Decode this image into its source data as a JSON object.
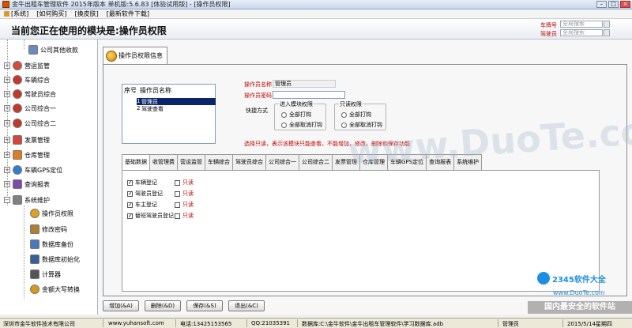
{
  "window": {
    "title": "金牛出租车管理软件 2015年版本 单机版:5.6.83 [体验试用版] - [操作员权限]"
  },
  "menu": [
    {
      "label": "[系统]"
    },
    {
      "label": "[如何购买]"
    },
    {
      "label": "[换皮肤]"
    },
    {
      "label": "[最新软件下载]"
    }
  ],
  "header": {
    "current_module": "当前您正在使用的模块是:操作员权限",
    "plate_label": "车牌号",
    "plate_placeholder": "全局搜索",
    "driver_label": "驾驶员",
    "driver_placeholder": "全局搜索"
  },
  "sidebar": {
    "items": [
      {
        "label": "公司其他收款",
        "icon": "document-icon",
        "color": "#6a8bbf"
      },
      {
        "label": "营运监管",
        "icon": "globe-icon",
        "color": "#d24b3c"
      },
      {
        "label": "车辆综合",
        "icon": "globe-icon",
        "color": "#c0392b"
      },
      {
        "label": "驾驶员综合",
        "icon": "globe-icon",
        "color": "#c0392b"
      },
      {
        "label": "公司综合一",
        "icon": "globe-icon",
        "color": "#c0392b"
      },
      {
        "label": "公司综合二",
        "icon": "globe-icon",
        "color": "#c0392b"
      },
      {
        "label": "发票管理",
        "icon": "invoice-icon",
        "color": "#d44638"
      },
      {
        "label": "仓库管理",
        "icon": "warehouse-icon",
        "color": "#e07b1f"
      },
      {
        "label": "车辆GPS定位",
        "icon": "gps-icon",
        "color": "#2e7dd1"
      },
      {
        "label": "查询报表",
        "icon": "report-icon",
        "color": "#7c4aa8"
      },
      {
        "label": "系统维护",
        "icon": "settings-icon",
        "color": "#808080"
      },
      {
        "label": "操作员权限",
        "icon": "user-key-icon",
        "color": "#e0a020"
      },
      {
        "label": "修改密码",
        "icon": "key-icon",
        "color": "#b08030"
      },
      {
        "label": "数据库备份",
        "icon": "database-icon",
        "color": "#4a78b8"
      },
      {
        "label": "数据库初始化",
        "icon": "database-icon",
        "color": "#3a5f98"
      },
      {
        "label": "计算器",
        "icon": "calculator-icon",
        "color": "#555555"
      },
      {
        "label": "金额大写转换",
        "icon": "money-icon",
        "color": "#d49a1a"
      }
    ]
  },
  "page_tab": {
    "label": "操作员权限信息"
  },
  "operator_table": {
    "headers": [
      "序号",
      "操作员名称"
    ],
    "rows": [
      {
        "index": "1",
        "name": "管理员"
      },
      {
        "index": "2",
        "name": "驾驶查看"
      }
    ]
  },
  "form": {
    "name_label": "操作员名称",
    "name_value": "管理员",
    "password_label": "操作员密码",
    "password_value": "",
    "quick_label": "快捷方式",
    "enter_group_title": "进入模块权限",
    "enter_all_open": "全部打钩",
    "enter_all_cancel": "全部取消打钩",
    "readonly_group_title": "只读权限",
    "readonly_all_open": "全部打钩",
    "readonly_all_cancel": "全部取消打钩",
    "hint": "选择只读，表示该模块只能查看，不能增加，修改，删除和保存功能"
  },
  "tabs": [
    {
      "label": "基础数据"
    },
    {
      "label": "收管理费"
    },
    {
      "label": "营运监管"
    },
    {
      "label": "车辆综合"
    },
    {
      "label": "驾驶员综合"
    },
    {
      "label": "公司综合一"
    },
    {
      "label": "公司综合二"
    },
    {
      "label": "发票管理"
    },
    {
      "label": "仓库管理"
    },
    {
      "label": "车辆GPS定位"
    },
    {
      "label": "查询报表"
    },
    {
      "label": "系统维护"
    }
  ],
  "permissions": [
    {
      "label": "车辆登记",
      "checked": true,
      "readonly_label": "只读"
    },
    {
      "label": "驾驶员登记",
      "checked": true,
      "readonly_label": "只读"
    },
    {
      "label": "车主登记",
      "checked": true,
      "readonly_label": "只读"
    },
    {
      "label": "替班驾驶员登记",
      "checked": true,
      "readonly_label": "只读"
    }
  ],
  "buttons": {
    "add": "增加(&A)",
    "delete": "删除(&D)",
    "save": "保存(&S)",
    "exit": "退出(&C)"
  },
  "status": {
    "company": "深圳市金牛软件技术有限公司",
    "website": "www.yuhansoft.com",
    "phone": "电话:13425153565",
    "qq": "QQ:21035391",
    "database": "数据库:C:\\金牛软件\\金牛出租车管理软件\\学习数据库.adb",
    "user": "管理员",
    "date": "2015/5/14星期四"
  },
  "watermarks": {
    "duote": "www.DuoTe.com",
    "brand": "2345软件大全",
    "url": "www.DuoTe.com",
    "slogan": "国内最安全的软件站"
  },
  "colors": {
    "accent_red": "#c00000",
    "selection": "#0a246a"
  }
}
